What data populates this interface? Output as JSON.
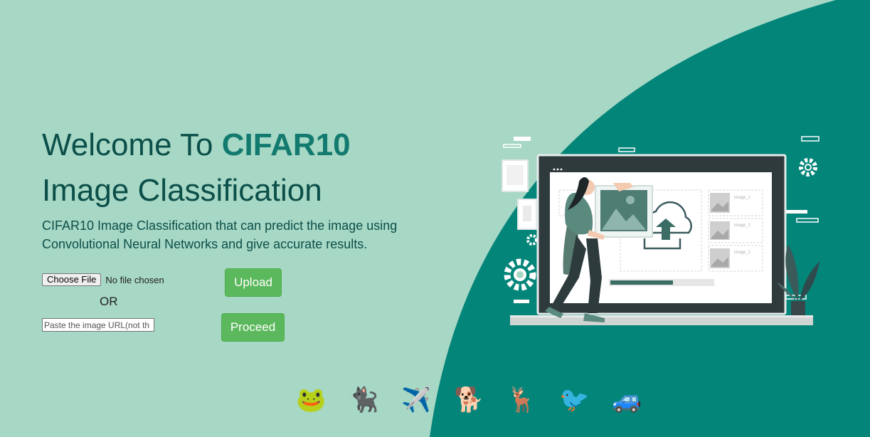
{
  "hero": {
    "title_prefix": "Welcome To ",
    "title_brand": "CIFAR10",
    "title_line2": "Image Classification",
    "description": "CIFAR10 Image Classification that can predict the image using Convolutional Neural Networks and give accurate results."
  },
  "form": {
    "choose_file_label": "Choose File",
    "no_file_text": "No file chosen",
    "or_text": "OR",
    "url_placeholder": "Paste the image URL(not th",
    "url_value": "",
    "upload_label": "Upload",
    "proceed_label": "Proceed"
  },
  "illustration": {
    "thumb_label": "image_1"
  },
  "class_icons": [
    {
      "name": "frog-icon",
      "glyph": "🐸"
    },
    {
      "name": "cat-icon",
      "glyph": "🐈‍⬛"
    },
    {
      "name": "airplane-icon",
      "glyph": "✈️"
    },
    {
      "name": "dog-icon",
      "glyph": "🐕"
    },
    {
      "name": "deer-icon",
      "glyph": "🦌"
    },
    {
      "name": "bird-icon",
      "glyph": "🐦"
    },
    {
      "name": "car-icon",
      "glyph": "🚙"
    }
  ],
  "colors": {
    "background": "#a7d7c5",
    "accent_shape": "#04857a",
    "title_text": "#0b4f49",
    "brand_text": "#127a6e",
    "button": "#5cb85c"
  }
}
